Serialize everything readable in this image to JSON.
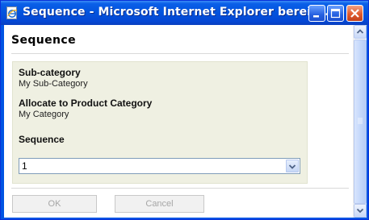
{
  "window": {
    "title": "Sequence - Microsoft Internet Explorer bereitg...",
    "icons": {
      "app": "ie-page-icon",
      "minimize": "minimize-icon",
      "maximize": "maximize-icon",
      "close": "close-icon"
    }
  },
  "page": {
    "heading": "Sequence",
    "fields": [
      {
        "label": "Sub-category",
        "value": "My Sub-Category"
      },
      {
        "label": "Allocate to Product Category",
        "value": "My Category"
      }
    ],
    "sequence": {
      "label": "Sequence",
      "selected": "1"
    }
  },
  "buttons": {
    "ok": "OK",
    "cancel": "Cancel"
  },
  "colors": {
    "titlebar": "#0054e3",
    "panel": "#eff0e2",
    "close": "#e05a2e"
  }
}
